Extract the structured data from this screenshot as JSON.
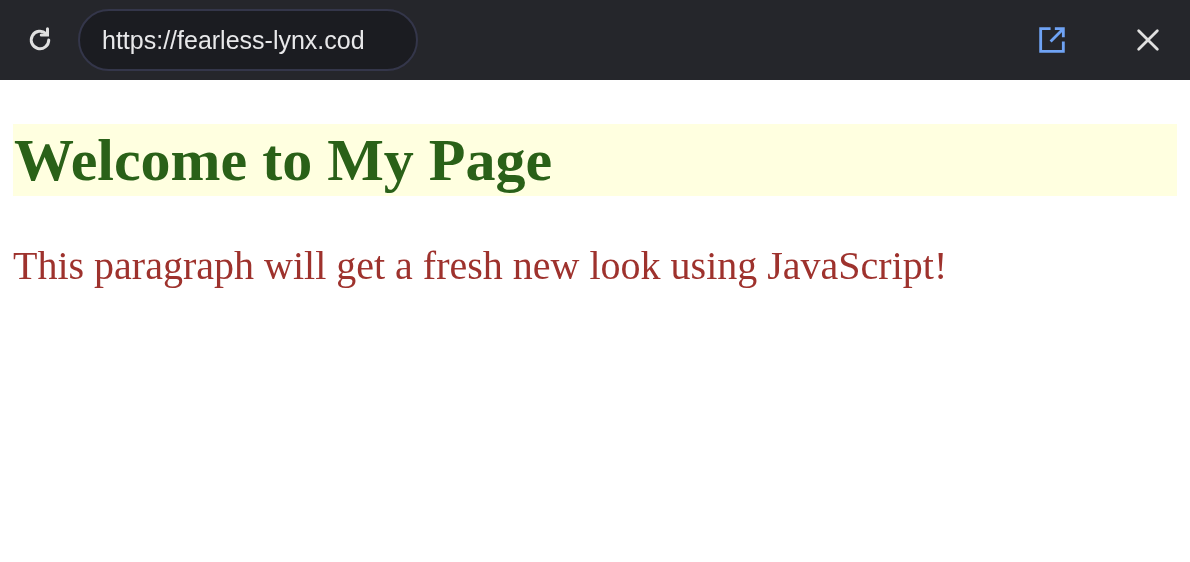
{
  "browser_bar": {
    "url": "https://fearless-lynx.cod"
  },
  "page": {
    "heading": "Welcome to My Page",
    "paragraph": "This paragraph will get a fresh new look using JavaScript!"
  }
}
